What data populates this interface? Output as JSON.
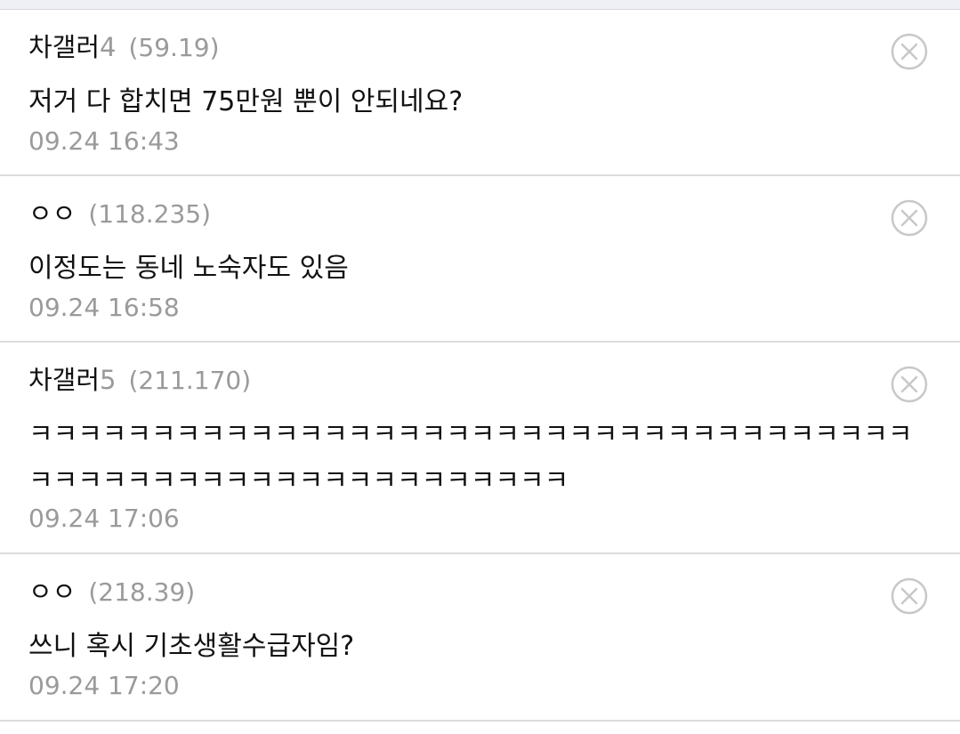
{
  "comments": [
    {
      "nickname": "차갤러",
      "nick_num": "4",
      "ip": "(59.19)",
      "text": "저거 다 합치면 75만원 뿐이 안되네요?",
      "date": "09.24 16:43"
    },
    {
      "nickname": "ㅇㅇ",
      "nick_num": "",
      "ip": "(118.235)",
      "text": "이정도는 동네 노숙자도 있음",
      "date": "09.24 16:58"
    },
    {
      "nickname": "차갤러",
      "nick_num": "5",
      "ip": "(211.170)",
      "text": "ㅋㅋㅋㅋㅋㅋㅋㅋㅋㅋㅋㅋㅋㅋㅋㅋㅋㅋㅋㅋㅋㅋㅋㅋㅋㅋㅋㅋㅋㅋㅋㅋㅋㅋㅋㅋㅋㅋㅋㅋㅋㅋㅋㅋㅋㅋㅋㅋㅋㅋㅋㅋㅋㅋㅋㅋㅋㅋ",
      "date": "09.24 17:06"
    },
    {
      "nickname": "ㅇㅇ",
      "nick_num": "",
      "ip": "(218.39)",
      "text": "쓰니 혹시 기초생활수급자임?",
      "date": "09.24 17:20"
    }
  ],
  "icons": {
    "delete": "close-circle-icon"
  },
  "colors": {
    "meta_gray": "#9a9a9a",
    "divider": "#dcdcdc",
    "icon_gray": "#c8c8c8"
  }
}
